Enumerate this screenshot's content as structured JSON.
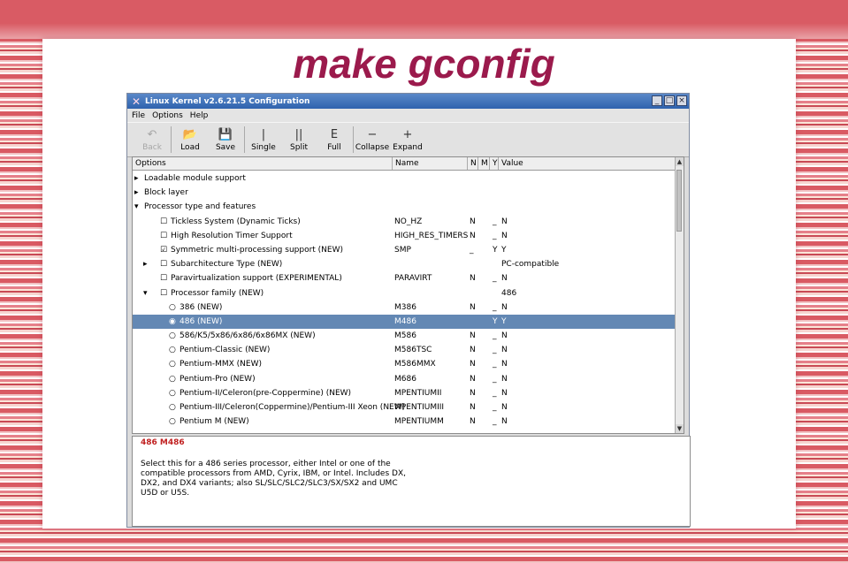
{
  "slide": {
    "title": "make gconfig"
  },
  "window": {
    "title": "Linux Kernel v2.6.21.5 Configuration",
    "controls": [
      "_",
      "□",
      "×"
    ]
  },
  "menu": [
    "File",
    "Options",
    "Help"
  ],
  "toolbar": [
    {
      "label": "Back",
      "icon": "↶",
      "icon_name": "back-arrow-icon",
      "disabled": true
    },
    {
      "label": "Load",
      "icon": "📂",
      "icon_name": "folder-open-icon",
      "disabled": false
    },
    {
      "label": "Save",
      "icon": "💾",
      "icon_name": "floppy-disk-icon",
      "disabled": false
    },
    {
      "label": "Single",
      "icon": "|",
      "icon_name": "single-view-icon",
      "disabled": false
    },
    {
      "label": "Split",
      "icon": "||",
      "icon_name": "split-view-icon",
      "disabled": false
    },
    {
      "label": "Full",
      "icon": "E",
      "icon_name": "full-view-icon",
      "disabled": false
    },
    {
      "label": "Collapse",
      "icon": "−",
      "icon_name": "collapse-icon",
      "disabled": false
    },
    {
      "label": "Expand",
      "icon": "+",
      "icon_name": "expand-icon",
      "disabled": false
    }
  ],
  "columns": {
    "options": "Options",
    "name": "Name",
    "n": "N",
    "m": "M",
    "y": "Y",
    "value": "Value"
  },
  "rows": [
    {
      "indent": 0,
      "expander": "▸",
      "mark": "",
      "label": "Loadable module support",
      "name": "",
      "n": "",
      "m": "",
      "y": "",
      "value": ""
    },
    {
      "indent": 0,
      "expander": "▸",
      "mark": "",
      "label": "Block layer",
      "name": "",
      "n": "",
      "m": "",
      "y": "",
      "value": ""
    },
    {
      "indent": 0,
      "expander": "▾",
      "mark": "",
      "label": "Processor type and features",
      "name": "",
      "n": "",
      "m": "",
      "y": "",
      "value": ""
    },
    {
      "indent": 1,
      "expander": "",
      "mark": "☐",
      "label": "Tickless System (Dynamic Ticks)",
      "name": "NO_HZ",
      "n": "N",
      "m": "_",
      "y": "",
      "value": "N"
    },
    {
      "indent": 1,
      "expander": "",
      "mark": "☐",
      "label": "High Resolution Timer Support",
      "name": "HIGH_RES_TIMERS",
      "n": "N",
      "m": "_",
      "y": "",
      "value": "N"
    },
    {
      "indent": 1,
      "expander": "",
      "mark": "☑",
      "label": "Symmetric multi-processing support (NEW)",
      "name": "SMP",
      "n": "_",
      "m": "",
      "y": "Y",
      "value": "Y"
    },
    {
      "indent": 1,
      "expander": "▸",
      "mark": "☐",
      "label": "Subarchitecture Type (NEW)",
      "name": "",
      "n": "",
      "m": "",
      "y": "",
      "value": "PC-compatible"
    },
    {
      "indent": 1,
      "expander": "",
      "mark": "☐",
      "label": "Paravirtualization support (EXPERIMENTAL)",
      "name": "PARAVIRT",
      "n": "N",
      "m": "_",
      "y": "",
      "value": "N"
    },
    {
      "indent": 1,
      "expander": "▾",
      "mark": "☐",
      "label": "Processor family (NEW)",
      "name": "",
      "n": "",
      "m": "",
      "y": "",
      "value": "486"
    },
    {
      "indent": 2,
      "expander": "",
      "mark": "○",
      "label": "386 (NEW)",
      "name": "M386",
      "n": "N",
      "m": "_",
      "y": "",
      "value": "N"
    },
    {
      "indent": 2,
      "expander": "",
      "mark": "◉",
      "label": "486 (NEW)",
      "name": "M486",
      "n": "",
      "m": "",
      "y": "Y",
      "value": "Y",
      "selected": true
    },
    {
      "indent": 2,
      "expander": "",
      "mark": "○",
      "label": "586/K5/5x86/6x86/6x86MX (NEW)",
      "name": "M586",
      "n": "N",
      "m": "_",
      "y": "",
      "value": "N"
    },
    {
      "indent": 2,
      "expander": "",
      "mark": "○",
      "label": "Pentium-Classic (NEW)",
      "name": "M586TSC",
      "n": "N",
      "m": "_",
      "y": "",
      "value": "N"
    },
    {
      "indent": 2,
      "expander": "",
      "mark": "○",
      "label": "Pentium-MMX (NEW)",
      "name": "M586MMX",
      "n": "N",
      "m": "_",
      "y": "",
      "value": "N"
    },
    {
      "indent": 2,
      "expander": "",
      "mark": "○",
      "label": "Pentium-Pro (NEW)",
      "name": "M686",
      "n": "N",
      "m": "_",
      "y": "",
      "value": "N"
    },
    {
      "indent": 2,
      "expander": "",
      "mark": "○",
      "label": "Pentium-II/Celeron(pre-Coppermine) (NEW)",
      "name": "MPENTIUMII",
      "n": "N",
      "m": "_",
      "y": "",
      "value": "N"
    },
    {
      "indent": 2,
      "expander": "",
      "mark": "○",
      "label": "Pentium-III/Celeron(Coppermine)/Pentium-III Xeon (NEW)",
      "name": "MPENTIUMIII",
      "n": "N",
      "m": "_",
      "y": "",
      "value": "N"
    },
    {
      "indent": 2,
      "expander": "",
      "mark": "○",
      "label": "Pentium M (NEW)",
      "name": "MPENTIUMM",
      "n": "N",
      "m": "_",
      "y": "",
      "value": "N"
    }
  ],
  "help": {
    "title": "486 M486",
    "text": "Select this for a 486 series processor, either Intel or one of the compatible processors from AMD, Cyrix, IBM, or Intel.  Includes DX, DX2, and DX4 variants; also SL/SLC/SLC2/SLC3/SX/SX2 and UMC U5D or U5S."
  },
  "colors": {
    "title": "#9b1a4c",
    "selection": "#6388b4",
    "titlebar": "#2f63ae",
    "help_title": "#c02020"
  }
}
